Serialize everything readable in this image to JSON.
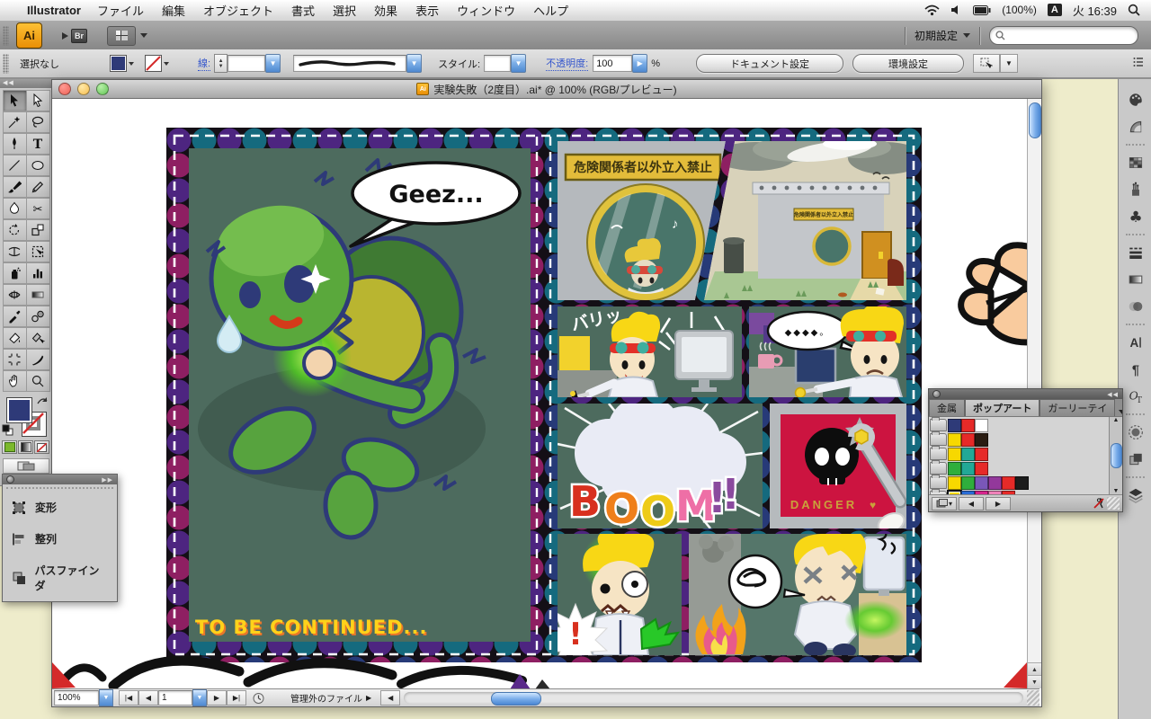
{
  "menubar": {
    "app_name": "Illustrator",
    "menus": [
      "ファイル",
      "編集",
      "オブジェクト",
      "書式",
      "選択",
      "効果",
      "表示",
      "ウィンドウ",
      "ヘルプ"
    ],
    "status_right": {
      "battery_label": "(100%)",
      "input_badge": "A",
      "clock": "火 16:39"
    }
  },
  "appbar": {
    "logo": "Ai",
    "bridge_label": "Br",
    "workspace_label": "初期設定",
    "search_value": ""
  },
  "controlbar": {
    "selection_status": "選択なし",
    "stroke_label": "線:",
    "style_label": "スタイル:",
    "opacity_label": "不透明度:",
    "opacity_value": "100",
    "opacity_unit": "%",
    "document_setup_button": "ドキュメント設定",
    "preferences_button": "環境設定"
  },
  "window": {
    "title": "実験失敗（2度目）.ai* @ 100% (RGB/プレビュー)"
  },
  "statusbar": {
    "zoom_value": "100%",
    "artboard_value": "1",
    "status_text": "管理外のファイル"
  },
  "artwork": {
    "speech_bubble": "Geez...",
    "sign_text": "危険関係者以外立入禁止",
    "small_sign_text": "危険関係者以外立入禁止",
    "sfx_crack": "バリッ",
    "silence_dots": "◆◆◆◆。",
    "boom_text": "BOOM!!",
    "boom_colors": [
      "#d8301e",
      "#ef7f1a",
      "#eecb18",
      "#ee6fa6",
      "#8a4a9e",
      "#8a4a9e"
    ],
    "danger_text": "DANGER",
    "danger_heart": "♥",
    "exclamation": "!",
    "to_be_continued": "TO BE CONTINUED..."
  },
  "panels": {
    "actions": {
      "items": [
        "変形",
        "整列",
        "パスファインダ"
      ]
    },
    "swatches": {
      "tabs": [
        "金属",
        "ポップアート",
        "ガーリーテイ"
      ],
      "active_tab": "ポップアート",
      "rows": [
        {
          "colors": [
            "#2e3a78",
            "#e62a28",
            "#ffffff"
          ]
        },
        {
          "colors": [
            "#f7d800",
            "#e62a28",
            "#2a1c12"
          ]
        },
        {
          "colors": [
            "#f7d800",
            "#22a896",
            "#e62a28"
          ]
        },
        {
          "colors": [
            "#2fae3c",
            "#22a896",
            "#e62a28"
          ]
        },
        {
          "colors": [
            "#f7d800",
            "#2fae3c",
            "#7a57b8",
            "#93389b",
            "#e62a28",
            "#1c1c1c"
          ]
        },
        {
          "colors": [
            "#f7d800",
            "#2a6cd6",
            "#d6258c",
            "#ef82b9",
            "#e62a28"
          ],
          "selected": 0
        },
        {
          "colors": [
            "#22a896",
            "#2a6cd6",
            "#e62a28"
          ]
        }
      ]
    }
  },
  "tool_icons": [
    "selection",
    "direct-selection",
    "magic-wand",
    "lasso",
    "pen",
    "type",
    "line-segment",
    "ellipse",
    "paintbrush",
    "pencil",
    "blob-brush",
    "scissors",
    "rotate",
    "scale",
    "width",
    "free-transform",
    "symbol-sprayer",
    "column-graph",
    "mesh",
    "gradient",
    "eyedropper",
    "blend",
    "live-paint-bucket",
    "live-paint-selection",
    "artboard",
    "slice",
    "hand",
    "zoom"
  ],
  "dock_icons": [
    "color",
    "color-guide",
    "swatches",
    "brushes",
    "symbols",
    "stroke",
    "gradient",
    "transparency",
    "character",
    "paragraph",
    "opentype",
    "appearance",
    "graphic-styles",
    "layers"
  ],
  "colors": {
    "accent_aqua": "#6ea6e0",
    "desktop": "#eeeccb",
    "comic_panel_bg": "#4d6b5e",
    "fill_swatch": "#2e3a78",
    "polka": [
      "#4d2580",
      "#156a7e",
      "#8e1f62",
      "#273a78"
    ]
  }
}
